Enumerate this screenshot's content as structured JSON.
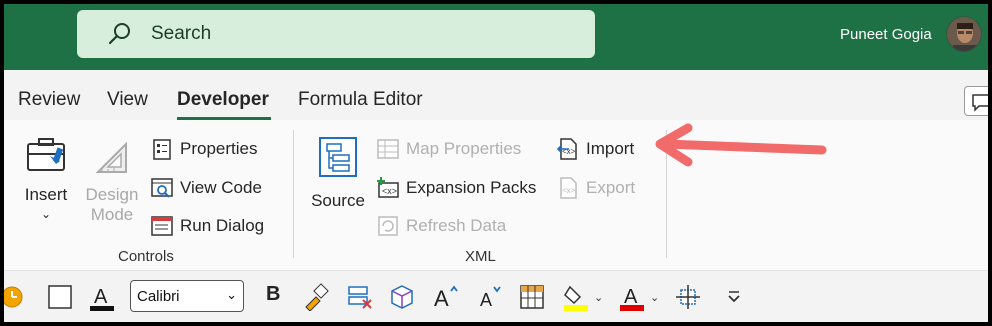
{
  "titlebar": {
    "search_placeholder": "Search",
    "user_name": "Puneet Gogia"
  },
  "tabs": [
    {
      "label": "Review"
    },
    {
      "label": "View"
    },
    {
      "label": "Developer"
    },
    {
      "label": "Formula Editor"
    }
  ],
  "ribbon": {
    "controls": {
      "group_label": "Controls",
      "insert_label": "Insert",
      "design_mode_line1": "Design",
      "design_mode_line2": "Mode",
      "properties_label": "Properties",
      "view_code_label": "View Code",
      "run_dialog_label": "Run Dialog"
    },
    "xml": {
      "group_label": "XML",
      "source_label": "Source",
      "map_properties_label": "Map Properties",
      "expansion_packs_label": "Expansion Packs",
      "refresh_data_label": "Refresh Data",
      "import_label": "Import",
      "export_label": "Export"
    }
  },
  "qat": {
    "font_name": "Calibri",
    "bold_label": "B"
  },
  "colors": {
    "titlebar_bg": "#1e7145",
    "search_bg": "#d7eedd",
    "annotation_arrow": "#f26b6b",
    "highlight_yellow": "#ffff00",
    "font_red": "#e00000"
  }
}
